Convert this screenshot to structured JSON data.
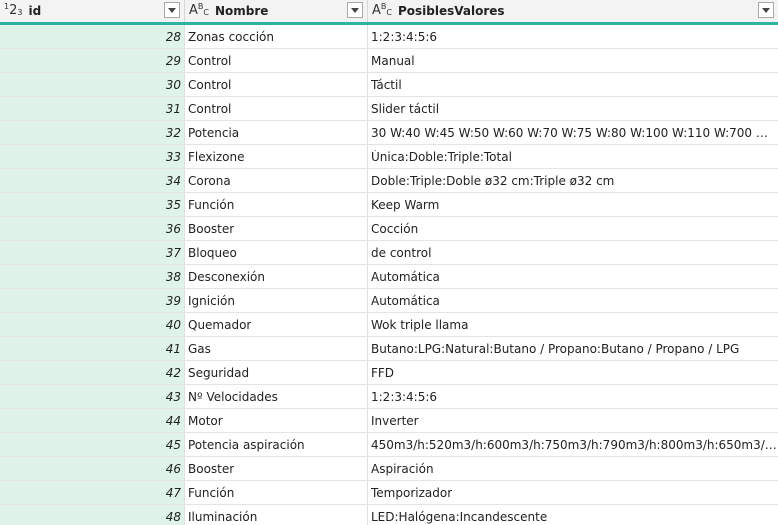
{
  "columns": [
    {
      "key": "id",
      "label": "id",
      "type_icon": "number-type-icon"
    },
    {
      "key": "nombre",
      "label": "Nombre",
      "type_icon": "text-type-icon"
    },
    {
      "key": "vals",
      "label": "PosiblesValores",
      "type_icon": "text-type-icon"
    }
  ],
  "colors": {
    "accent": "#2bb5a0",
    "id_column_bg": "#dff3e9",
    "header_bg": "#f3f3f3"
  },
  "rows": [
    {
      "id": "28",
      "nombre": "Zonas cocción",
      "vals": "1:2:3:4:5:6"
    },
    {
      "id": "29",
      "nombre": "Control",
      "vals": "Manual"
    },
    {
      "id": "30",
      "nombre": "Control",
      "vals": "Táctil"
    },
    {
      "id": "31",
      "nombre": "Control",
      "vals": "Slider táctil"
    },
    {
      "id": "32",
      "nombre": "Potencia",
      "vals": "30 W:40 W:45 W:50 W:60 W:70 W:75 W:80 W:100 W:110 W:700 W:8..."
    },
    {
      "id": "33",
      "nombre": "Flexizone",
      "vals": "Única:Doble:Triple:Total"
    },
    {
      "id": "34",
      "nombre": "Corona",
      "vals": "Doble:Triple:Doble ø32 cm:Triple ø32 cm"
    },
    {
      "id": "35",
      "nombre": "Función",
      "vals": "Keep Warm"
    },
    {
      "id": "36",
      "nombre": "Booster",
      "vals": "Cocción"
    },
    {
      "id": "37",
      "nombre": "Bloqueo",
      "vals": "de control"
    },
    {
      "id": "38",
      "nombre": "Desconexión",
      "vals": "Automática"
    },
    {
      "id": "39",
      "nombre": "Ignición",
      "vals": "Automática"
    },
    {
      "id": "40",
      "nombre": "Quemador",
      "vals": "Wok triple llama"
    },
    {
      "id": "41",
      "nombre": "Gas",
      "vals": "Butano:LPG:Natural:Butano / Propano:Butano / Propano / LPG"
    },
    {
      "id": "42",
      "nombre": "Seguridad",
      "vals": "FFD"
    },
    {
      "id": "43",
      "nombre": "Nº Velocidades",
      "vals": "1:2:3:4:5:6"
    },
    {
      "id": "44",
      "nombre": "Motor",
      "vals": "Inverter"
    },
    {
      "id": "45",
      "nombre": "Potencia aspiración",
      "vals": "450m3/h:520m3/h:600m3/h:750m3/h:790m3/h:800m3/h:650m3/h:4..."
    },
    {
      "id": "46",
      "nombre": "Booster",
      "vals": "Aspiración"
    },
    {
      "id": "47",
      "nombre": "Función",
      "vals": "Temporizador"
    },
    {
      "id": "48",
      "nombre": "Iluminación",
      "vals": "LED:Halógena:Incandescente"
    }
  ]
}
